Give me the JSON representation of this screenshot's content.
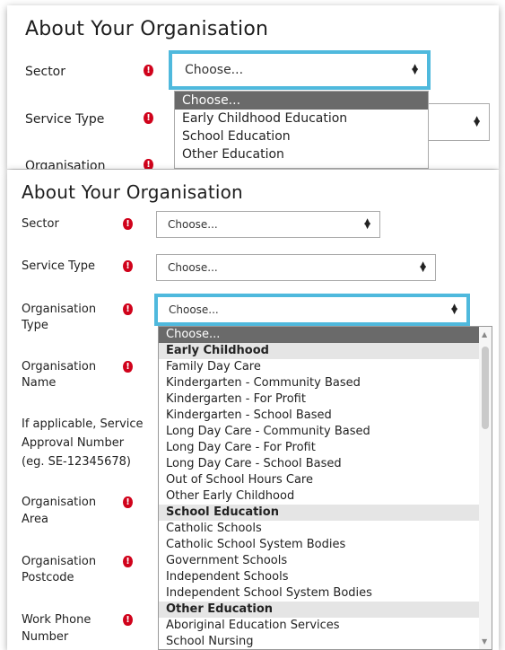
{
  "top": {
    "heading": "About Your Organisation",
    "sector_label": "Sector",
    "sector_value": "Choose...",
    "service_type_label": "Service Type",
    "organisation_label_partial": "Organisation",
    "dropdown": [
      "Choose...",
      "Early Childhood Education",
      "School Education",
      "Other Education"
    ]
  },
  "form": {
    "heading": "About Your Organisation",
    "sector_label": "Sector",
    "sector_value": "Choose...",
    "service_type_label": "Service Type",
    "service_type_value": "Choose...",
    "org_type_label_1": "Organisation",
    "org_type_label_2": "Type",
    "org_type_value": "Choose...",
    "org_name_label_1": "Organisation",
    "org_name_label_2": "Name",
    "sa_label_1": "If applicable, Service",
    "sa_label_2": "Approval Number",
    "sa_label_3": "(eg. SE-12345678)",
    "area_label_1": "Organisation",
    "area_label_2": "Area",
    "postcode_label_1": "Organisation",
    "postcode_label_2": "Postcode",
    "phone_label_1": "Work Phone",
    "phone_label_2": "Number",
    "required_mark": "!"
  },
  "org_type_options": [
    {
      "text": "Choose...",
      "kind": "highlight"
    },
    {
      "text": "Early Childhood",
      "kind": "group"
    },
    {
      "text": "Family Day Care",
      "kind": "option"
    },
    {
      "text": "Kindergarten - Community Based",
      "kind": "option"
    },
    {
      "text": "Kindergarten - For Profit",
      "kind": "option"
    },
    {
      "text": "Kindergarten - School Based",
      "kind": "option"
    },
    {
      "text": "Long Day Care - Community Based",
      "kind": "option"
    },
    {
      "text": "Long Day Care - For Profit",
      "kind": "option"
    },
    {
      "text": "Long Day Care - School Based",
      "kind": "option"
    },
    {
      "text": "Out of School Hours Care",
      "kind": "option"
    },
    {
      "text": "Other Early Childhood",
      "kind": "option"
    },
    {
      "text": "School Education",
      "kind": "group"
    },
    {
      "text": "Catholic Schools",
      "kind": "option"
    },
    {
      "text": "Catholic School System Bodies",
      "kind": "option"
    },
    {
      "text": "Government Schools",
      "kind": "option"
    },
    {
      "text": "Independent Schools",
      "kind": "option"
    },
    {
      "text": "Independent School System Bodies",
      "kind": "option"
    },
    {
      "text": "Other Education",
      "kind": "group"
    },
    {
      "text": "Aboriginal Education Services",
      "kind": "option"
    },
    {
      "text": "School Nursing",
      "kind": "option"
    }
  ],
  "colors": {
    "focus": "#4fb9dd",
    "required": "#d0021b",
    "highlight": "#6a6a6a",
    "group_bg": "#e5e5e5"
  },
  "icons": {
    "required": "exclamation-icon",
    "select_arrows": "up-down-arrows-icon"
  }
}
